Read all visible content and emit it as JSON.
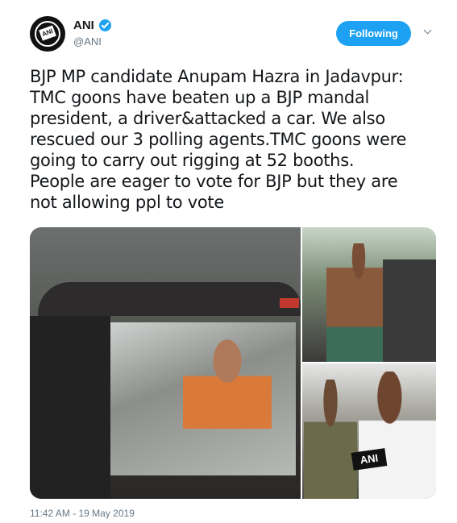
{
  "account": {
    "name": "ANI",
    "handle": "@ANI",
    "avatar_text": "ANI"
  },
  "follow_button": {
    "label": "Following"
  },
  "tweet": {
    "text": "BJP MP candidate Anupam Hazra in Jadavpur:\nTMC goons have beaten up a BJP mandal\npresident, a driver&attacked a car. We also\nrescued our 3 polling agents.TMC goons were\ngoing to carry out rigging at 52 booths.\nPeople are eager to vote for BJP but they are\nnot allowing ppl to vote",
    "timestamp": "11:42 AM - 19 May 2019"
  },
  "media": {
    "mic_label": "ANI"
  },
  "icons": [
    "verified-badge-icon",
    "chevron-down-icon"
  ],
  "colors": {
    "accent": "#1da1f2",
    "secondary_text": "#657786",
    "primary_text": "#14171a"
  }
}
